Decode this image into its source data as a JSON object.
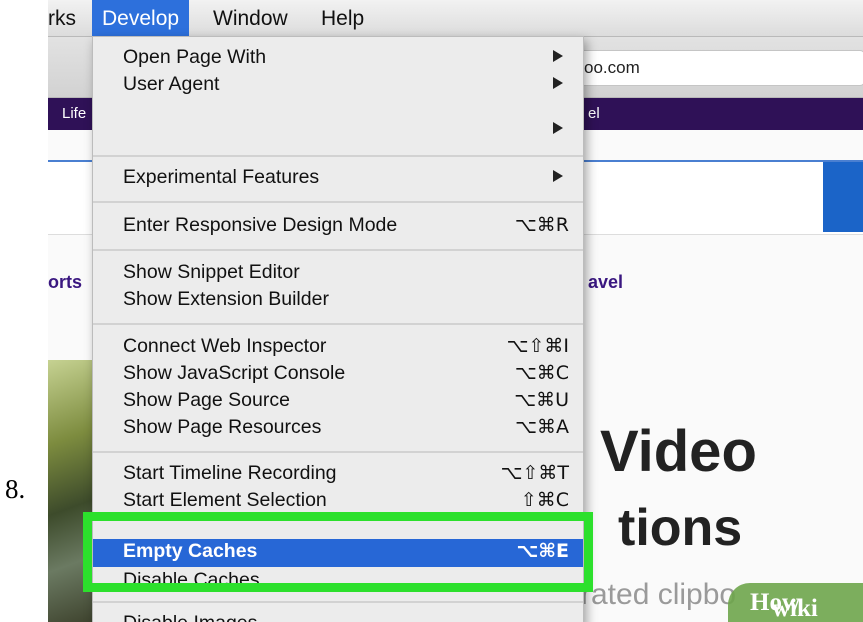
{
  "step_number": "8.",
  "menubar": {
    "items": [
      "rks",
      "Develop",
      "Window",
      "Help"
    ]
  },
  "browser": {
    "url_text": "oo.com",
    "favorites": [
      "Life",
      "el"
    ]
  },
  "page": {
    "nav_links": [
      "orts",
      "avel"
    ],
    "hero_line1": "Video",
    "hero_line2": "tions",
    "hero_sub": "rated clipbo"
  },
  "watermark": {
    "part1": "wiki",
    "part2": "How"
  },
  "develop_menu": {
    "items": [
      {
        "label": "Open Page With",
        "submenu": true
      },
      {
        "label": "User Agent",
        "submenu": true
      },
      {
        "label": "",
        "submenu": true
      },
      {
        "label": "Experimental Features",
        "submenu": true
      },
      {
        "label": "Enter Responsive Design Mode",
        "shortcut": "⌥⌘R"
      },
      {
        "label": "Show Snippet Editor"
      },
      {
        "label": "Show Extension Builder"
      },
      {
        "label": "Connect Web Inspector",
        "shortcut": "⌥⇧⌘I"
      },
      {
        "label": "Show JavaScript Console",
        "shortcut": "⌥⌘C"
      },
      {
        "label": "Show Page Source",
        "shortcut": "⌥⌘U"
      },
      {
        "label": "Show Page Resources",
        "shortcut": "⌥⌘A"
      },
      {
        "label": "Start Timeline Recording",
        "shortcut": "⌥⇧⌘T"
      },
      {
        "label": "Start Element Selection",
        "shortcut": "⇧⌘C"
      },
      {
        "label": "Empty Caches",
        "shortcut": "⌥⌘E",
        "highlighted": true
      },
      {
        "label": "Disable Caches"
      },
      {
        "label": "Disable Images"
      }
    ]
  },
  "colors": {
    "highlight": "#2767d6",
    "annotation": "#2ce02c",
    "favbar": "#2f1157"
  }
}
